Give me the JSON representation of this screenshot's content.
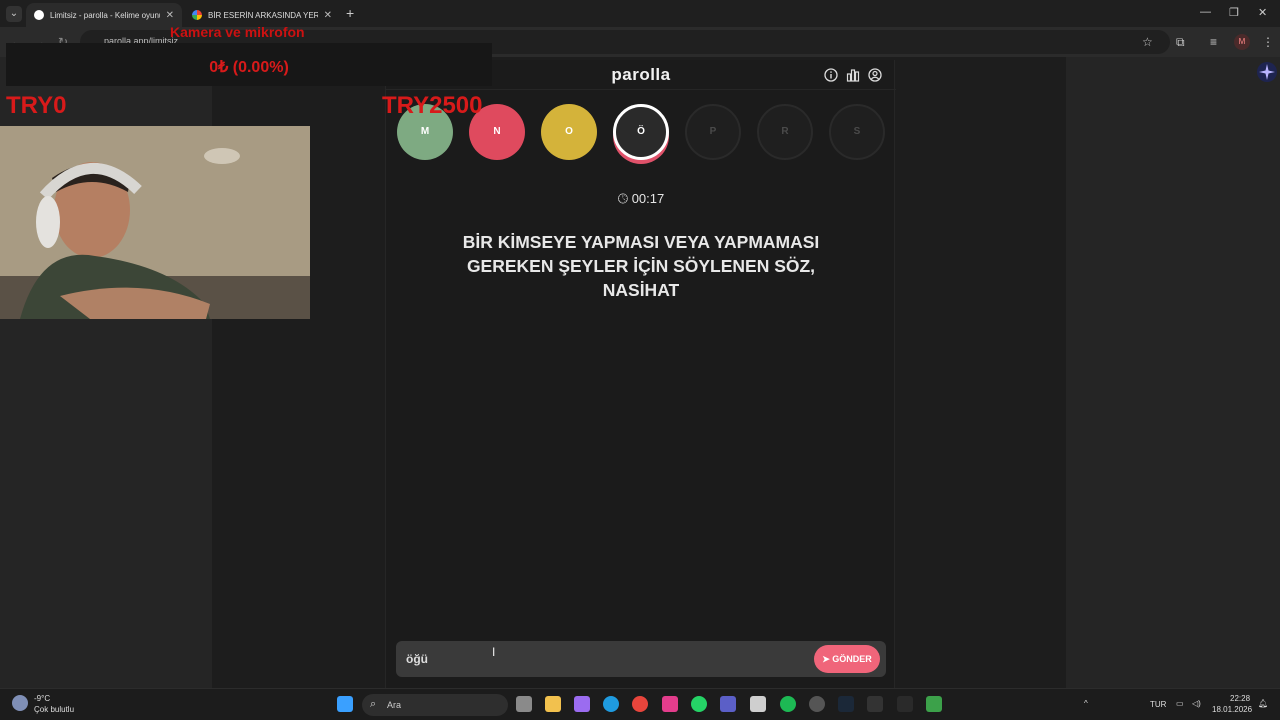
{
  "browser": {
    "tabs": [
      {
        "title": "Limitsiz - parolla - Kelime oyunu",
        "active": true
      },
      {
        "title": "BİR ESERİN ARKASINDA YER ALAN",
        "active": false
      }
    ],
    "url": "parolla.app/limitsiz",
    "profile_initial": "M"
  },
  "stream": {
    "overlay_title": "Kamera ve mikrofon",
    "balance": "0₺ (0.00%)",
    "tag_left": "TRY0",
    "tag_mid": "TRY2500"
  },
  "game": {
    "brand": "parolla",
    "letters": [
      {
        "letter": "M",
        "state": "correct",
        "color": "#7eaa82"
      },
      {
        "letter": "N",
        "state": "wrong",
        "color": "#df4a5e"
      },
      {
        "letter": "O",
        "state": "pass",
        "color": "#d4b33a"
      },
      {
        "letter": "Ö",
        "state": "current",
        "color": "#2a2a2a"
      },
      {
        "letter": "P",
        "state": "future",
        "color": "#1f1f1f"
      },
      {
        "letter": "R",
        "state": "future",
        "color": "#1f1f1f"
      },
      {
        "letter": "S",
        "state": "future",
        "color": "#1f1f1f"
      }
    ],
    "timer": "00:17",
    "question": "BİR KİMSEYE YAPMASI VEYA YAPMAMASI GEREKEN ŞEYLER İÇİN SÖYLENEN SÖZ, NASİHAT",
    "answer_value": "öğü",
    "send_label": "GÖNDER"
  },
  "taskbar": {
    "weather_temp": "-9°C",
    "weather_desc": "Çok bulutlu",
    "search_label": "Ara",
    "language": "TUR",
    "time": "22:28",
    "date": "18.01.2026"
  },
  "colors": {
    "accent": "#f0657a",
    "overlay_red": "#d81a1a"
  }
}
